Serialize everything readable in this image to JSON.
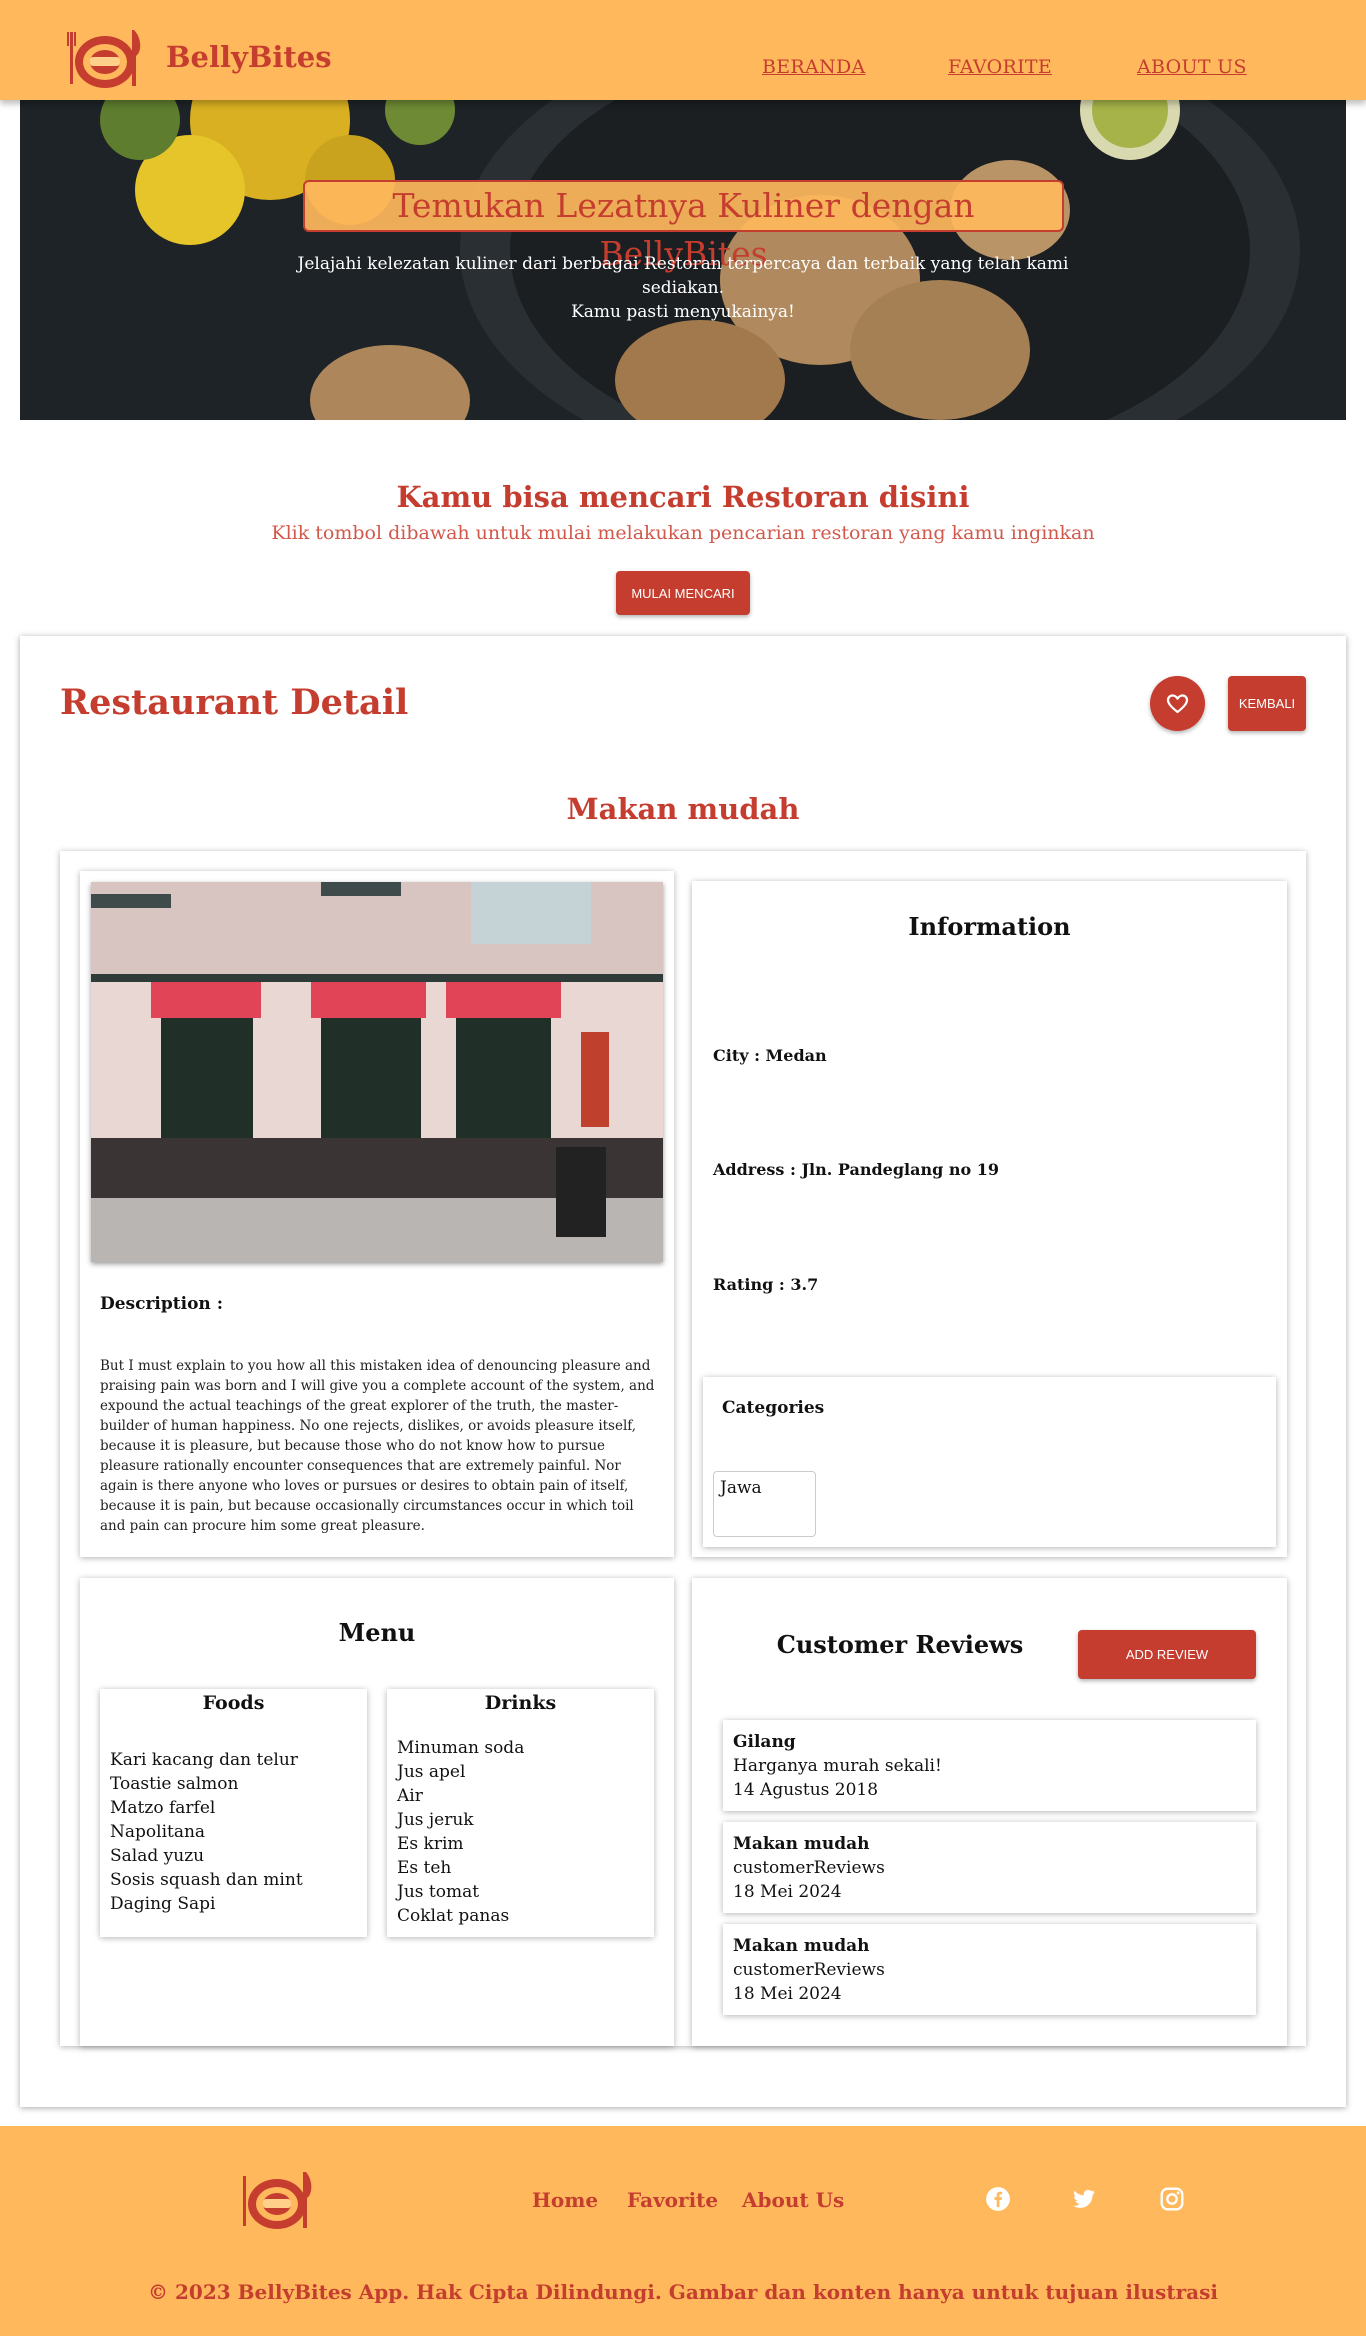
{
  "header": {
    "brand": "BellyBites",
    "nav": [
      "BERANDA",
      "FAVORITE",
      "ABOUT US"
    ]
  },
  "hero": {
    "title": "Temukan Lezatnya Kuliner dengan BellyBites",
    "subtitle_line1": "Jelajahi kelezatan kuliner dari berbagai Restoran terpercaya dan terbaik yang telah kami sediakan.",
    "subtitle_line2": "Kamu pasti menyukainya!"
  },
  "search": {
    "title": "Kamu bisa mencari Restoran disini",
    "subtitle": "Klik tombol dibawah untuk mulai melakukan pencarian restoran yang kamu inginkan",
    "button": "MULAI MENCARI"
  },
  "detail": {
    "title": "Restaurant Detail",
    "back_button": "KEMBALI",
    "favorite_icon": "heart-outline-icon",
    "name": "Makan mudah",
    "description_label": "Description :",
    "description": "But I must explain to you how all this mistaken idea of denouncing pleasure and praising pain was born and I will give you a complete account of the system, and expound the actual teachings of the great explorer of the truth, the master-builder of human happiness. No one rejects, dislikes, or avoids pleasure itself, because it is pleasure, but because those who do not know how to pursue pleasure rationally encounter consequences that are extremely painful. Nor again is there anyone who loves or pursues or desires to obtain pain of itself, because it is pain, but because occasionally circumstances occur in which toil and pain can procure him some great pleasure.",
    "information": {
      "title": "Information",
      "city": "City : Medan",
      "address": "Address : Jln. Pandeglang no 19",
      "rating": "Rating : 3.7"
    },
    "categories": {
      "title": "Categories",
      "items": [
        "Jawa"
      ]
    },
    "menu": {
      "title": "Menu",
      "foods_title": "Foods",
      "foods": [
        "Kari kacang dan telur",
        "Toastie salmon",
        "Matzo farfel",
        "Napolitana",
        "Salad yuzu",
        "Sosis squash dan mint",
        "Daging Sapi"
      ],
      "drinks_title": "Drinks",
      "drinks": [
        "Minuman soda",
        "Jus apel",
        "Air",
        "Jus jeruk",
        "Es krim",
        "Es teh",
        "Jus tomat",
        "Coklat panas"
      ]
    },
    "reviews": {
      "title": "Customer Reviews",
      "add_button": "ADD REVIEW",
      "items": [
        {
          "name": "Gilang",
          "review": "Harganya murah sekali!",
          "date": "14 Agustus 2018"
        },
        {
          "name": "Makan mudah",
          "review": "customerReviews",
          "date": "18 Mei 2024"
        },
        {
          "name": "Makan mudah",
          "review": "customerReviews",
          "date": "18 Mei 2024"
        }
      ]
    }
  },
  "footer": {
    "links": [
      "Home",
      "Favorite",
      "About Us"
    ],
    "social_icons": [
      "facebook-icon",
      "twitter-icon",
      "instagram-icon"
    ],
    "copyright": "© 2023 BellyBites App. Hak Cipta Dilindungi. Gambar dan konten hanya untuk tujuan ilustrasi"
  },
  "colors": {
    "accent": "#c53d2f",
    "header_bg": "#ffb85c"
  }
}
